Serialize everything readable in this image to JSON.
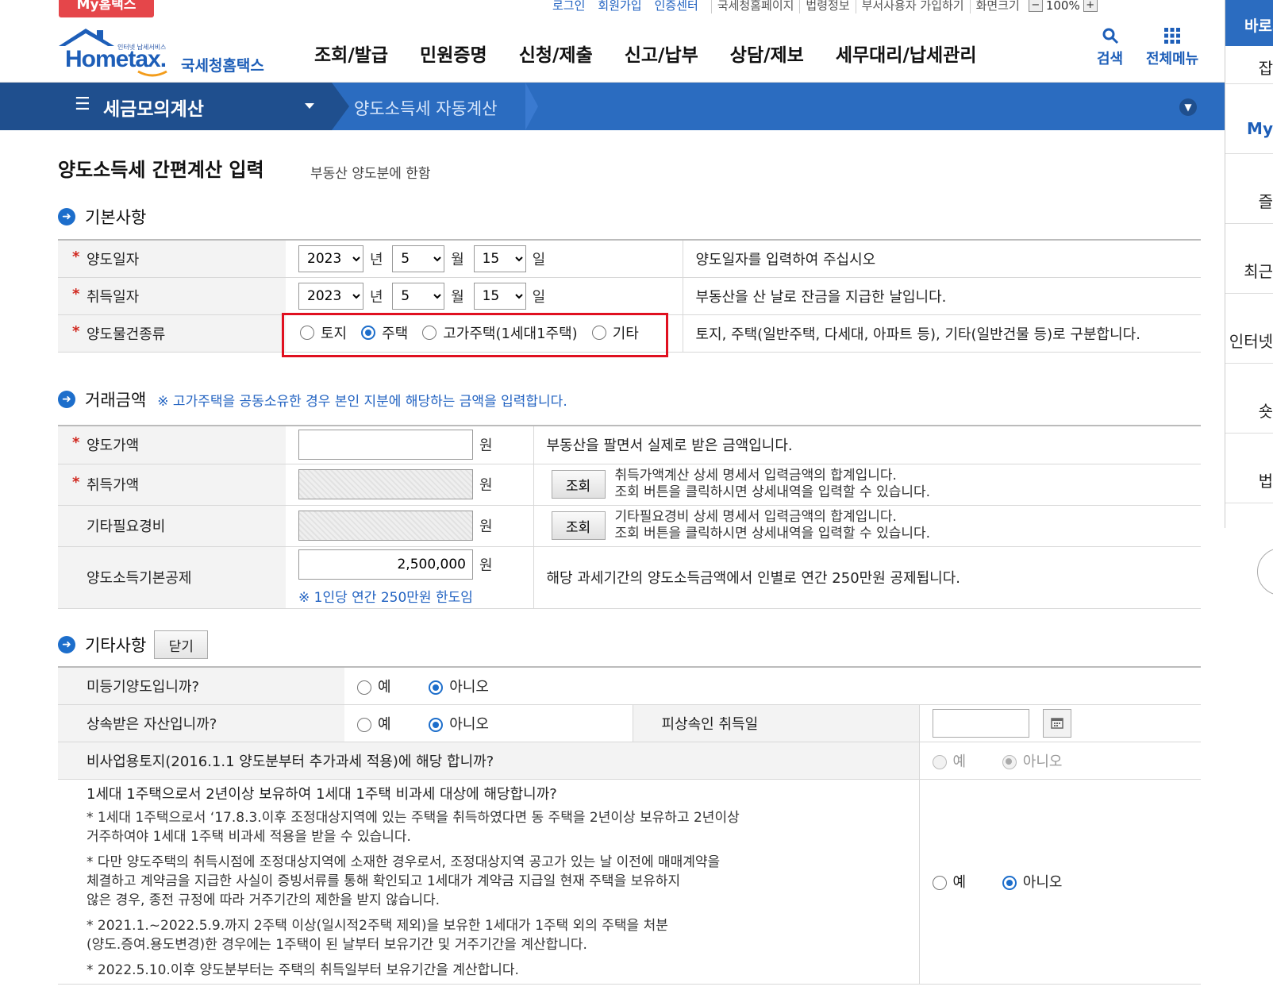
{
  "util": {
    "my_tab": "My홈택스",
    "login": "로그인",
    "signup": "회원가입",
    "cert": "인증센터",
    "links": [
      "국세청홈페이지",
      "법령정보",
      "부서사용자 가입하기",
      "화면크기"
    ],
    "zoom_minus": "−",
    "zoom_value": "100%",
    "zoom_plus": "+"
  },
  "header": {
    "logo_tagline": "인터넷 납세서비스",
    "logo_home": "Hometax.",
    "logo_kr": "국세청홈택스",
    "gnb": [
      "조회/발급",
      "민원증명",
      "신청/제출",
      "신고/납부",
      "상담/제보",
      "세무대리/납세관리"
    ],
    "search": "검색",
    "all_menu": "전체메뉴"
  },
  "nav": {
    "title": "세금모의계산",
    "sub": "양도소득세 자동계산"
  },
  "side": {
    "top": "바로가기",
    "items": [
      "잡",
      "My",
      "즐",
      "최근",
      "인터넷",
      "숏",
      "법"
    ]
  },
  "page": {
    "title": "양도소득세 간편계산 입력",
    "subtitle": "부동산 양도분에 한함"
  },
  "basic": {
    "heading": "기본사항",
    "transfer_date": {
      "label": "양도일자",
      "year": "2023",
      "month": "5",
      "day": "15",
      "desc": "양도일자를 입력하여 주십시오"
    },
    "acquire_date": {
      "label": "취득일자",
      "year": "2023",
      "month": "5",
      "day": "15",
      "desc": "부동산을 산 날로 잔금을 지급한 날입니다."
    },
    "unit_year": "년",
    "unit_month": "월",
    "unit_day": "일",
    "property_type": {
      "label": "양도물건종류",
      "options": [
        "토지",
        "주택",
        "고가주택(1세대1주택)",
        "기타"
      ],
      "selected": "주택",
      "desc": "토지, 주택(일반주택, 다세대, 아파트 등), 기타(일반건물 등)로 구분합니다."
    }
  },
  "amount": {
    "heading": "거래금액",
    "note": "※ 고가주택을 공동소유한 경우 본인 지분에 해당하는 금액을 입력합니다.",
    "won": "원",
    "transfer_price": {
      "label": "양도가액",
      "value": "",
      "desc": "부동산을 팔면서 실제로 받은 금액입니다."
    },
    "acquire_price": {
      "label": "취득가액",
      "button": "조회",
      "desc1": "취득가액계산 상세 명세서 입력금액의 합계입니다.",
      "desc2": "조회 버튼을 클릭하시면 상세내역을 입력할 수 있습니다."
    },
    "other_expense": {
      "label": "기타필요경비",
      "button": "조회",
      "desc1": "기타필요경비 상세 명세서 입력금액의 합계입니다.",
      "desc2": "조회 버튼을 클릭하시면 상세내역을 입력할 수 있습니다."
    },
    "basic_deduction": {
      "label": "양도소득기본공제",
      "value": "2,500,000",
      "note": "※ 1인당 연간 250만원 한도임",
      "desc": "해당 과세기간의 양도소득금액에서 인별로 연간 250만원 공제됩니다."
    }
  },
  "other": {
    "heading": "기타사항",
    "close_button": "닫기",
    "yes": "예",
    "no": "아니오",
    "unregistered": {
      "question": "미등기양도입니까?",
      "selected": "아니오"
    },
    "inherited": {
      "question": "상속받은 자산입니까?",
      "selected": "아니오",
      "sub_label": "피상속인 취득일",
      "date_value": ""
    },
    "non_business_land": {
      "question": "비사업용토지(2016.1.1 양도분부터 추가과세 적용)에 해당 합니까?",
      "selected": "아니오",
      "disabled": true
    },
    "one_house": {
      "question": "1세대 1주택으로서 2년이상 보유하여 1세대 1주택 비과세 대상에 해당합니까?",
      "notes": [
        "* 1세대 1주택으로서 ‘17.8.3.이후 조정대상지역에 있는 주택을 취득하였다면 동 주택을 2년이상 보유하고 2년이상",
        "거주하여야 1세대 1주택 비과세 적용을 받을 수 있습니다.",
        "* 다만 양도주택의 취득시점에 조정대상지역에 소재한 경우로서, 조정대상지역 공고가 있는 날 이전에 매매계약을",
        "체결하고 계약금을 지급한 사실이 증빙서류를 통해 확인되고 1세대가 계약금 지급일 현재 주택을 보유하지",
        "않은 경우, 종전 규정에 따라 거주기간의 제한을 받지 않습니다.",
        "* 2021.1.~2022.5.9.까지 2주택 이상(일시적2주택 제외)을 보유한 1세대가 1주택 외의 주택을 처분",
        "(양도.증여.용도변경)한 경우에는 1주택이 된 날부터 보유기간 및 거주기간을 계산합니다.",
        "* 2022.5.10.이후 양도분부터는 주택의 취득일부터 보유기간을 계산합니다."
      ],
      "selected": "아니오"
    }
  },
  "colors": {
    "brand_blue": "#1d5eb8",
    "nav_dark": "#1f4f8e",
    "nav_light": "#2b6cc0",
    "highlight_red": "#e01020",
    "required_red": "#d0281f"
  }
}
